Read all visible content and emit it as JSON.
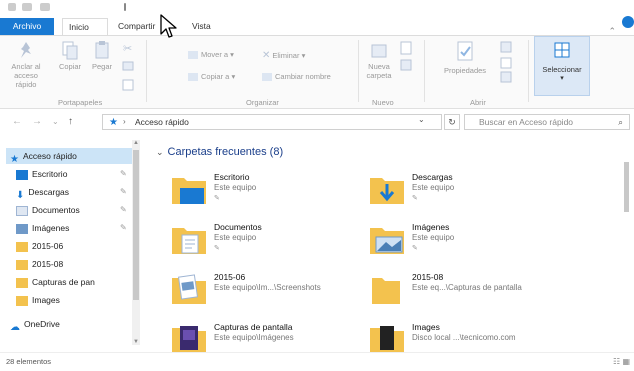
{
  "ribbon_tabs": {
    "file": "Archivo",
    "home": "Inicio",
    "share": "Compartir",
    "view": "Vista"
  },
  "ribbon": {
    "pin_quick_access": "Anclar al acceso rápido",
    "copy": "Copiar",
    "paste": "Pegar",
    "move_to": "Mover a",
    "copy_to": "Copiar a",
    "delete": "Eliminar",
    "rename": "Cambiar nombre",
    "new_folder": "Nueva carpeta",
    "properties": "Propiedades",
    "select": "Seleccionar",
    "groups": {
      "clipboard": "Portapapeles",
      "organize": "Organizar",
      "new": "Nuevo",
      "open": "Abrir"
    }
  },
  "address": {
    "path": "Acceso rápido",
    "search_placeholder": "Buscar en Acceso rápido"
  },
  "nav": {
    "items": [
      {
        "label": "Acceso rápido",
        "icon": "star-icon"
      },
      {
        "label": "Escritorio",
        "icon": "desktop-icon"
      },
      {
        "label": "Descargas",
        "icon": "download-icon"
      },
      {
        "label": "Documentos",
        "icon": "documents-icon"
      },
      {
        "label": "Imágenes",
        "icon": "pictures-icon"
      },
      {
        "label": "2015-06",
        "icon": "folder-icon"
      },
      {
        "label": "2015-08",
        "icon": "folder-icon"
      },
      {
        "label": "Capturas de pan",
        "icon": "folder-icon"
      },
      {
        "label": "Images",
        "icon": "folder-icon"
      },
      {
        "label": "OneDrive",
        "icon": "cloud-icon"
      }
    ]
  },
  "content": {
    "section_title": "Carpetas frecuentes (8)",
    "items": [
      {
        "name": "Escritorio",
        "location": "Este equipo",
        "icon": "desktop-folder-icon"
      },
      {
        "name": "Descargas",
        "location": "Este equipo",
        "icon": "downloads-folder-icon"
      },
      {
        "name": "Documentos",
        "location": "Este equipo",
        "icon": "documents-folder-icon"
      },
      {
        "name": "Imágenes",
        "location": "Este equipo",
        "icon": "pictures-folder-icon"
      },
      {
        "name": "2015-06",
        "location": "Este equipo\\Im...\\Screenshots",
        "icon": "document-folder-icon"
      },
      {
        "name": "2015-08",
        "location": "Este eq...\\Capturas de pantalla",
        "icon": "folder-icon"
      },
      {
        "name": "Capturas de pantalla",
        "location": "Este equipo\\Imágenes",
        "icon": "screenshots-folder-icon"
      },
      {
        "name": "Images",
        "location": "Disco local ...\\tecnicomo.com",
        "icon": "images-folder-icon"
      }
    ]
  },
  "status": {
    "count": "28 elementos"
  },
  "colors": {
    "accent": "#1979d2",
    "folder": "#f3c24e",
    "selected_bg": "#cce4f7"
  }
}
